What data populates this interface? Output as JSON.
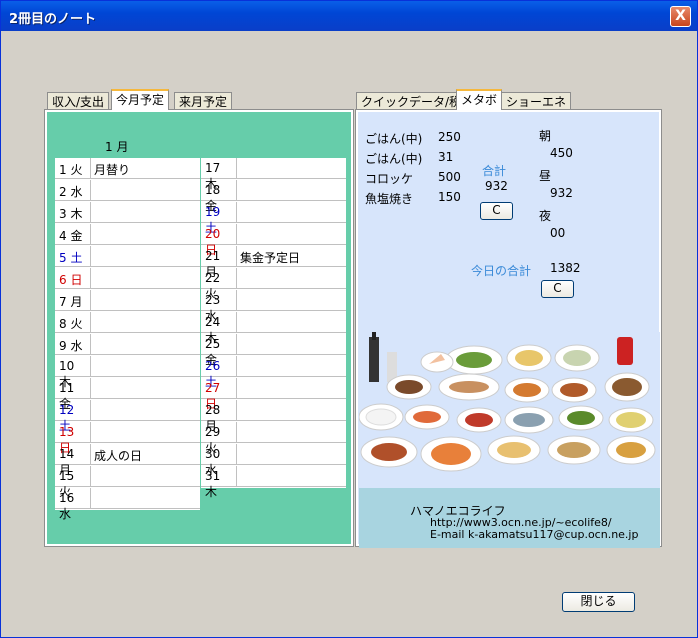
{
  "window": {
    "title": "2冊目のノート",
    "close_label": "X"
  },
  "left_tabs": [
    {
      "label": "収入/支出"
    },
    {
      "label": "今月予定"
    },
    {
      "label": "来月予定"
    }
  ],
  "right_tabs": [
    {
      "label": "クイックデータ/税金"
    },
    {
      "label": "メタボ"
    },
    {
      "label": "ショーエネ"
    }
  ],
  "calendar": {
    "month_title": "1 月",
    "left_days": [
      {
        "day": "1 火",
        "note": "月替り",
        "type": "weekday"
      },
      {
        "day": "2 水",
        "note": "",
        "type": "weekday"
      },
      {
        "day": "3 木",
        "note": "",
        "type": "weekday"
      },
      {
        "day": "4 金",
        "note": "",
        "type": "weekday"
      },
      {
        "day": "5 土",
        "note": "",
        "type": "sat"
      },
      {
        "day": "6 日",
        "note": "",
        "type": "sun"
      },
      {
        "day": "7 月",
        "note": "",
        "type": "weekday"
      },
      {
        "day": "8 火",
        "note": "",
        "type": "weekday"
      },
      {
        "day": "9 水",
        "note": "",
        "type": "weekday"
      },
      {
        "day": "10 木",
        "note": "",
        "type": "weekday"
      },
      {
        "day": "11 金",
        "note": "",
        "type": "weekday"
      },
      {
        "day": "12 土",
        "note": "",
        "type": "sat"
      },
      {
        "day": "13 日",
        "note": "",
        "type": "sun"
      },
      {
        "day": "14 月",
        "note": "成人の日",
        "type": "weekday"
      },
      {
        "day": "15 火",
        "note": "",
        "type": "weekday"
      },
      {
        "day": "16 水",
        "note": "",
        "type": "weekday"
      }
    ],
    "right_days": [
      {
        "day": "17 木",
        "note": "",
        "type": "weekday"
      },
      {
        "day": "18 金",
        "note": "",
        "type": "weekday"
      },
      {
        "day": "19 土",
        "note": "",
        "type": "sat"
      },
      {
        "day": "20 日",
        "note": "",
        "type": "sun"
      },
      {
        "day": "21 月",
        "note": "集金予定日",
        "type": "weekday"
      },
      {
        "day": "22 火",
        "note": "",
        "type": "weekday"
      },
      {
        "day": "23 水",
        "note": "",
        "type": "weekday"
      },
      {
        "day": "24 木",
        "note": "",
        "type": "weekday"
      },
      {
        "day": "25 金",
        "note": "",
        "type": "weekday"
      },
      {
        "day": "26 土",
        "note": "",
        "type": "sat"
      },
      {
        "day": "27 日",
        "note": "",
        "type": "sun"
      },
      {
        "day": "28 月",
        "note": "",
        "type": "weekday"
      },
      {
        "day": "29 火",
        "note": "",
        "type": "weekday"
      },
      {
        "day": "30 水",
        "note": "",
        "type": "weekday"
      },
      {
        "day": "31 木",
        "note": "",
        "type": "weekday"
      }
    ]
  },
  "metabo": {
    "foods": [
      {
        "name": "ごはん(中)",
        "kcal": "250"
      },
      {
        "name": "ごはん(中)",
        "kcal": "31"
      },
      {
        "name": "コロッケ",
        "kcal": "500"
      },
      {
        "name": "魚塩焼き",
        "kcal": "150"
      }
    ],
    "total_label": "合計",
    "total_value": "932",
    "clear_label": "C",
    "breakfast_label": "朝",
    "breakfast_value": "450",
    "lunch_label": "昼",
    "lunch_value": "932",
    "dinner_label": "夜",
    "dinner_value": "00",
    "today_total_label": "今日の合計",
    "today_total_value": "1382",
    "clear2_label": "C"
  },
  "footer": {
    "brand": "ハマノエコライフ",
    "url": "http://www3.ocn.ne.jp/~ecolife8/",
    "email": "E-mail  k-akamatsu117@cup.ocn.ne.jp"
  },
  "close_button_label": "閉じる"
}
